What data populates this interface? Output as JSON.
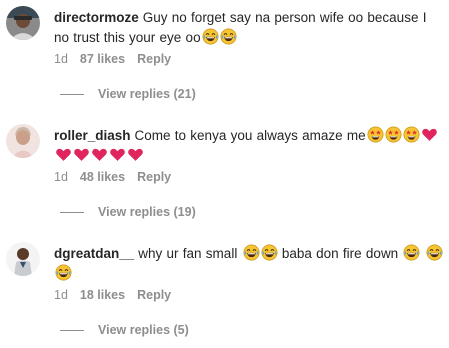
{
  "comments": [
    {
      "username": "directormoze",
      "text": "Guy no forget say na person wife oo because I no trust this your eye oo",
      "emojis": [
        "laughing-tears-emoji",
        "laughing-tears-emoji"
      ],
      "time": "1d",
      "likes": "87 likes",
      "reply_label": "Reply",
      "view_replies": "View replies (21)"
    },
    {
      "username": "roller_diash",
      "text": "Come to kenya you always amaze me",
      "emojis": [
        "star-struck-emoji",
        "star-struck-emoji",
        "star-struck-emoji",
        "red-heart-emoji",
        "red-heart-emoji",
        "red-heart-emoji",
        "red-heart-emoji",
        "red-heart-emoji",
        "red-heart-emoji"
      ],
      "time": "1d",
      "likes": "48 likes",
      "reply_label": "Reply",
      "view_replies": "View replies (19)"
    },
    {
      "username": "dgreatdan__",
      "text_part1": "why ur fan small",
      "text_part2": "baba don fire down",
      "emojis": [
        "laughing-tears-emoji",
        "laughing-tears-emoji",
        "laughing-tears-emoji",
        "laughing-tears-emoji",
        "laughing-tears-emoji"
      ],
      "time": "1d",
      "likes": "18 likes",
      "reply_label": "Reply",
      "view_replies": "View replies (5)"
    }
  ],
  "colors": {
    "text": "#262626",
    "secondary": "#8e8e8e",
    "heart": "#e0245e",
    "emoji_face": "#f7c531"
  }
}
